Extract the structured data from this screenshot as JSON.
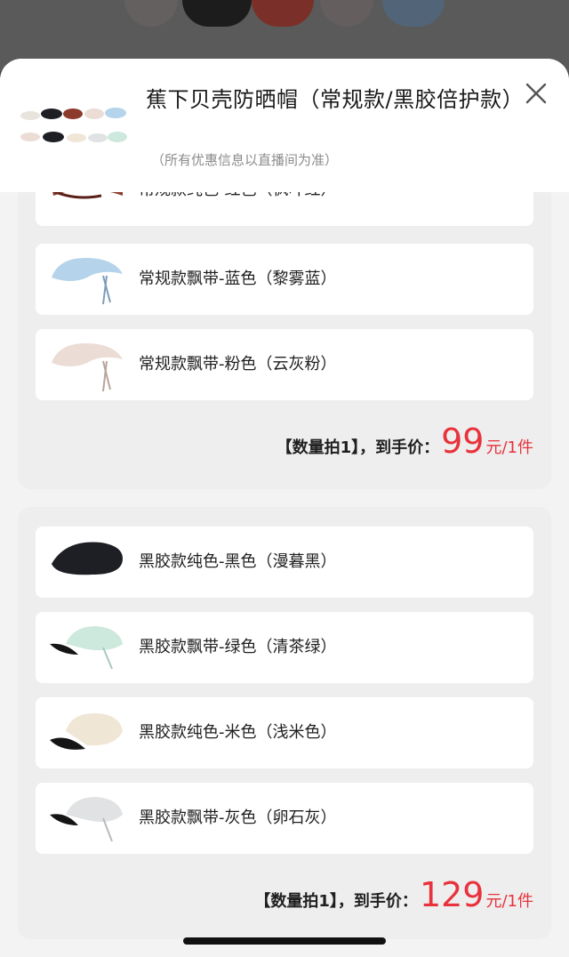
{
  "header": {
    "title": "蕉下贝壳防晒帽（常规款/黑胶倍护款）",
    "subtitle": "（所有优惠信息以直播间为准）",
    "close_icon": "close-icon"
  },
  "groups": [
    {
      "items": [
        {
          "label": "常规款纯色-红色（枫叶红）",
          "color": "#8c3a2c"
        },
        {
          "label": "常规款飘带-蓝色（黎雾蓝）",
          "color": "#b5d3ea"
        },
        {
          "label": "常规款飘带-粉色（云灰粉）",
          "color": "#ecdcd6"
        }
      ],
      "price": {
        "prefix": "【数量拍1】，到手价：",
        "amount": "99",
        "unit": "元/1件"
      }
    },
    {
      "items": [
        {
          "label": "黑胶款纯色-黑色（漫暮黑）",
          "color": "#1e1f24"
        },
        {
          "label": "黑胶款飘带-绿色（清茶绿）",
          "color": "#cde8dc"
        },
        {
          "label": "黑胶款纯色-米色（浅米色）",
          "color": "#efe6d6"
        },
        {
          "label": "黑胶款飘带-灰色（卵石灰）",
          "color": "#e0e2e4"
        }
      ],
      "price": {
        "prefix": "【数量拍1】，到手价：",
        "amount": "129",
        "unit": "元/1件"
      }
    }
  ]
}
